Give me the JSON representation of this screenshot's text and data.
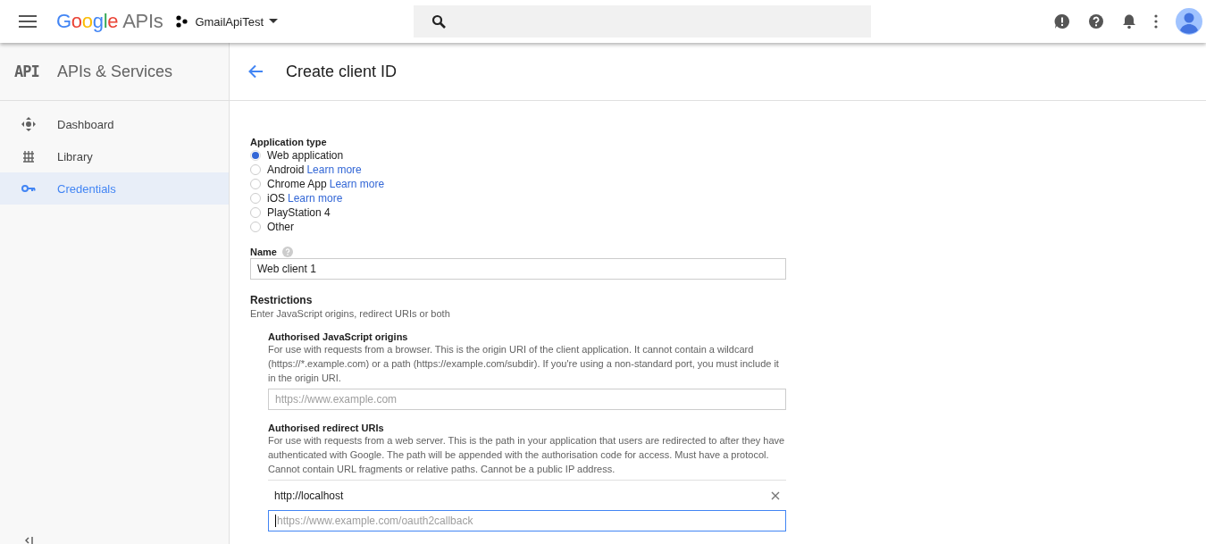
{
  "topbar": {
    "brand": "Google",
    "product": "APIs",
    "project": "GmailApiTest"
  },
  "sidebar": {
    "logo": "API",
    "title": "APIs & Services",
    "items": [
      {
        "label": "Dashboard",
        "selected": false
      },
      {
        "label": "Library",
        "selected": false
      },
      {
        "label": "Credentials",
        "selected": true
      }
    ]
  },
  "page": {
    "title": "Create client ID"
  },
  "form": {
    "application_type": {
      "label": "Application type",
      "options": [
        {
          "label": "Web application",
          "selected": true
        },
        {
          "label": "Android",
          "link": "Learn more",
          "selected": false
        },
        {
          "label": "Chrome App",
          "link": "Learn more",
          "selected": false
        },
        {
          "label": "iOS",
          "link": "Learn more",
          "selected": false
        },
        {
          "label": "PlayStation 4",
          "selected": false
        },
        {
          "label": "Other",
          "selected": false
        }
      ]
    },
    "name": {
      "label": "Name",
      "value": "Web client 1"
    },
    "restrictions": {
      "title": "Restrictions",
      "hint": "Enter JavaScript origins, redirect URIs or both",
      "sections": [
        {
          "title": "Authorised JavaScript origins",
          "description": "For use with requests from a browser. This is the origin URI of the client application. It cannot contain a wildcard (https://*.example.com) or a path (https://example.com/subdir). If you're using a non-standard port, you must include it in the origin URI.",
          "placeholder": "https://www.example.com",
          "focused": false
        },
        {
          "title": "Authorised redirect URIs",
          "description": "For use with requests from a web server. This is the path in your application that users are redirected to after they have authenticated with Google. The path will be appended with the authorisation code for access. Must have a protocol. Cannot contain URL fragments or relative paths. Cannot be a public IP address.",
          "entries": [
            "http://localhost"
          ],
          "placeholder": "https://www.example.com/oauth2callback",
          "focused": true
        }
      ]
    }
  }
}
